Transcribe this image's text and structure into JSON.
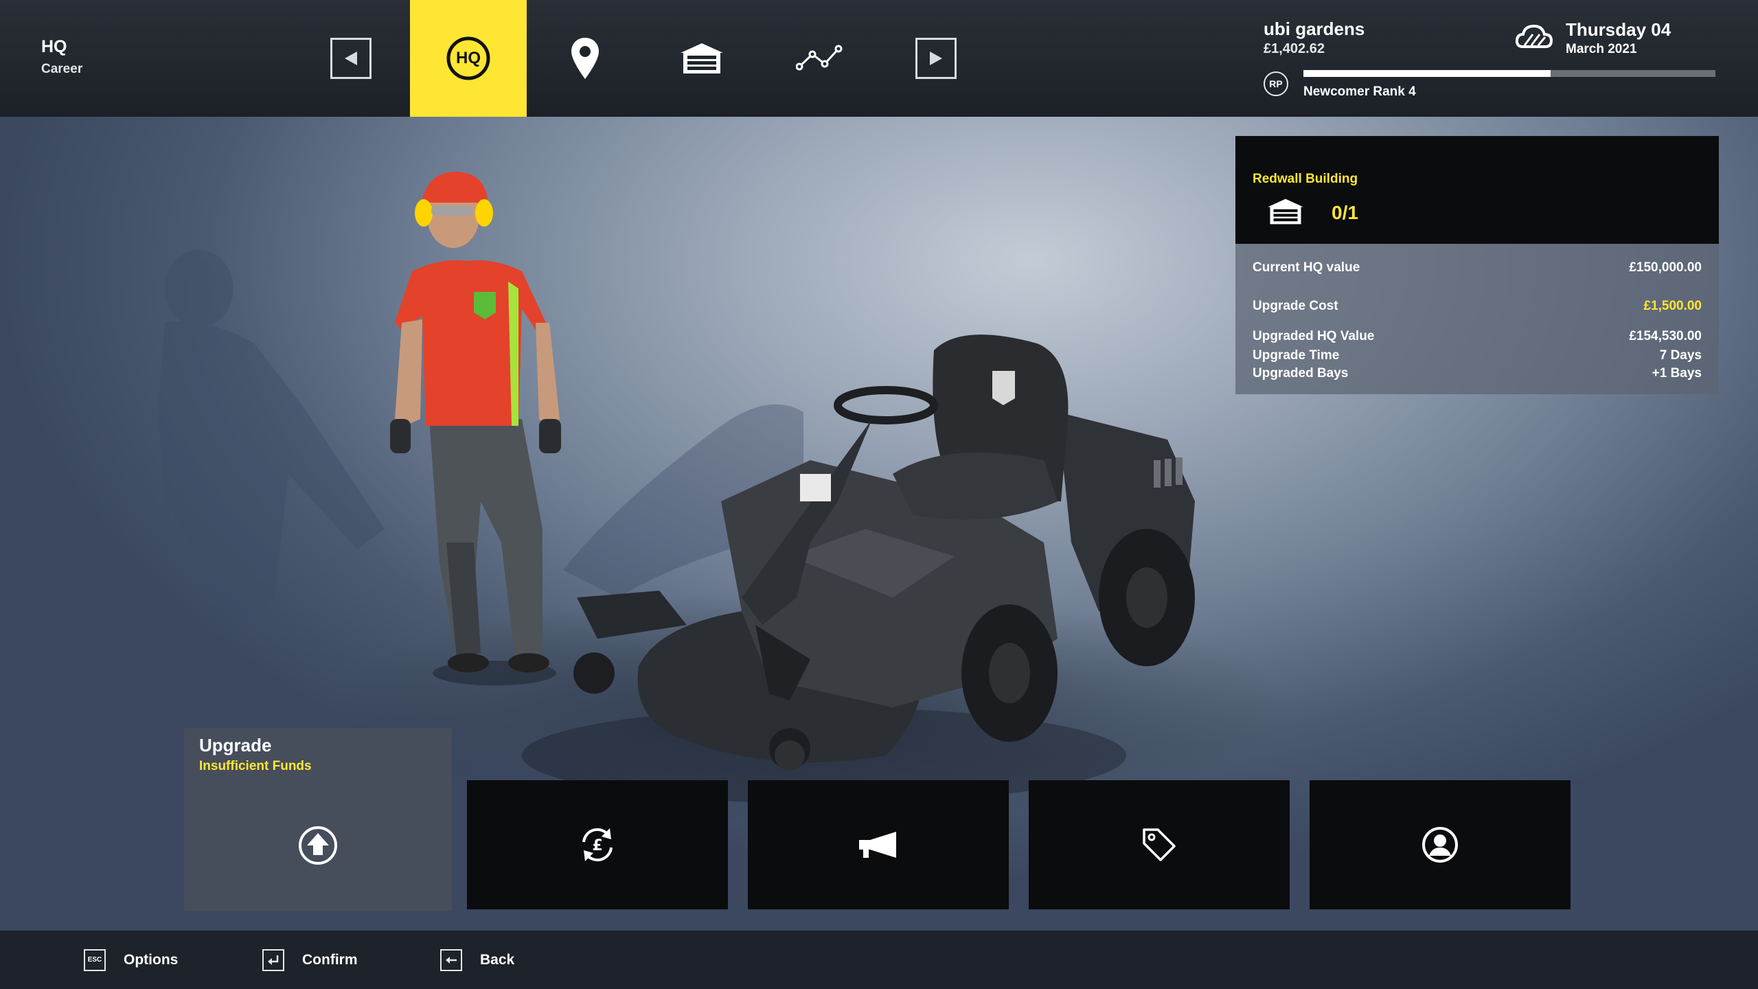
{
  "header": {
    "title": "HQ",
    "subtitle": "Career"
  },
  "nav": {
    "items": [
      {
        "name": "prev",
        "icon": "triangle-left-icon"
      },
      {
        "name": "hq",
        "icon": "hq-badge-icon",
        "label": "HQ",
        "active": true
      },
      {
        "name": "map",
        "icon": "map-pin-icon"
      },
      {
        "name": "garage",
        "icon": "garage-icon"
      },
      {
        "name": "stats",
        "icon": "graph-icon"
      },
      {
        "name": "next",
        "icon": "triangle-right-icon"
      }
    ],
    "accent_color": "#ffe633"
  },
  "company": {
    "name": "ubi gardens",
    "money": "£1,402.62",
    "rp_label": "RP",
    "rank": "Newcomer Rank 4",
    "rank_progress": 0.6
  },
  "date": {
    "weather_icon": "cloud-icon",
    "day": "Thursday 04",
    "month": "March 2021"
  },
  "info": {
    "building_name": "Redwall Building",
    "bays": "0/1",
    "rows": [
      {
        "label": "Current HQ value",
        "value": "£150,000.00"
      },
      {
        "label": "Upgrade Cost",
        "value": "£1,500.00",
        "highlight": true
      },
      {
        "label": "Upgraded HQ Value",
        "value": "£154,530.00"
      },
      {
        "label": "Upgrade Time",
        "value": "7 Days"
      },
      {
        "label": "Upgraded Bays",
        "value": "+1 Bays"
      }
    ]
  },
  "actions": {
    "selected_title": "Upgrade",
    "selected_status": "Insufficient Funds",
    "cards": [
      {
        "name": "upgrade",
        "icon": "upload-circle-icon"
      },
      {
        "name": "sell",
        "icon": "pound-exchange-icon"
      },
      {
        "name": "advertise",
        "icon": "megaphone-icon"
      },
      {
        "name": "tag",
        "icon": "tag-icon"
      },
      {
        "name": "staff",
        "icon": "user-circle-icon"
      }
    ]
  },
  "footer": {
    "options_key": "ESC",
    "options_label": "Options",
    "confirm_label": "Confirm",
    "back_label": "Back"
  }
}
